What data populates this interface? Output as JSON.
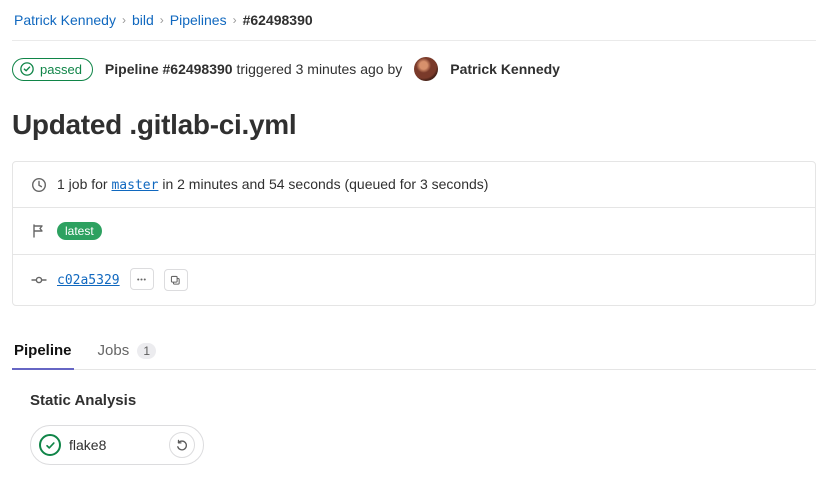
{
  "breadcrumb": {
    "user": "Patrick Kennedy",
    "project": "bild",
    "section": "Pipelines",
    "current": "#62498390"
  },
  "status": {
    "badge": "passed",
    "pipeline_label": "Pipeline #62498390",
    "trigger_mid": " triggered 3 minutes ago by ",
    "author": "Patrick Kennedy"
  },
  "commit_title": "Updated .gitlab-ci.yml",
  "summary": {
    "prefix": "1 job for ",
    "branch": "master",
    "suffix": " in 2 minutes and 54 seconds (queued for 3 seconds)"
  },
  "tag_latest": "latest",
  "commit_sha": "c02a5329",
  "tabs": {
    "pipeline": "Pipeline",
    "jobs": "Jobs",
    "jobs_count": "1"
  },
  "stage": {
    "name": "Static Analysis",
    "job": "flake8"
  }
}
